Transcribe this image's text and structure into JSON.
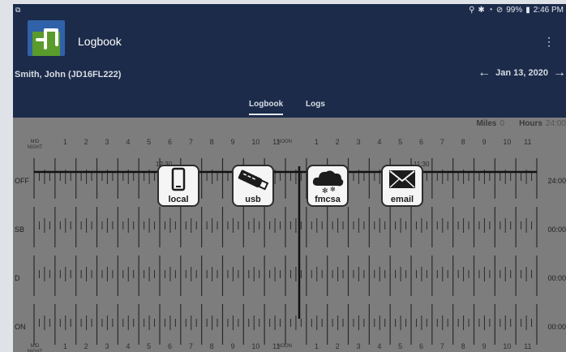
{
  "status_bar": {
    "notification": "⧉",
    "icons": [
      "location-icon",
      "bluetooth-icon",
      "wifi-icon",
      "block-icon"
    ],
    "battery": "99%",
    "time": "2:46 PM"
  },
  "app": {
    "title": "Logbook",
    "menu_glyph": "⋮"
  },
  "driver": "Smith, John (JD16FL222)",
  "date_nav": {
    "date": "Jan 13, 2020",
    "prev": "←",
    "next": "→"
  },
  "tabs": [
    {
      "label": "Logbook",
      "active": true
    },
    {
      "label": "Logs",
      "active": false
    }
  ],
  "totals": {
    "miles_label": "Miles",
    "miles_value": "0",
    "hours_label": "Hours",
    "hours_value": "24:00"
  },
  "hour_labels_top": [
    "MID NIGHT",
    "1",
    "2",
    "3",
    "4",
    "5",
    "6",
    "7",
    "8",
    "9",
    "10",
    "11",
    "NOON",
    "1",
    "2",
    "3",
    "4",
    "5",
    "6",
    "7",
    "8",
    "9",
    "10",
    "11"
  ],
  "hour_labels_bottom": [
    "MID NIGHT",
    "1",
    "2",
    "3",
    "4",
    "5",
    "6",
    "7",
    "8",
    "9",
    "10",
    "11",
    "NOON",
    "1",
    "2",
    "3",
    "4",
    "5",
    "6",
    "7",
    "8",
    "9",
    "10",
    "11"
  ],
  "statuses": [
    {
      "label": "OFF",
      "total": "24:00"
    },
    {
      "label": "SB",
      "total": "00:00"
    },
    {
      "label": "D",
      "total": "00:00"
    },
    {
      "label": "ON",
      "total": "00:00"
    }
  ],
  "time_marks": [
    "12:30",
    "11:30"
  ],
  "export_options": [
    {
      "label": "local",
      "icon": "phone-icon"
    },
    {
      "label": "usb",
      "icon": "usb-drive-icon"
    },
    {
      "label": "fmcsa",
      "icon": "cloud-icon"
    },
    {
      "label": "email",
      "icon": "envelope-icon"
    }
  ]
}
